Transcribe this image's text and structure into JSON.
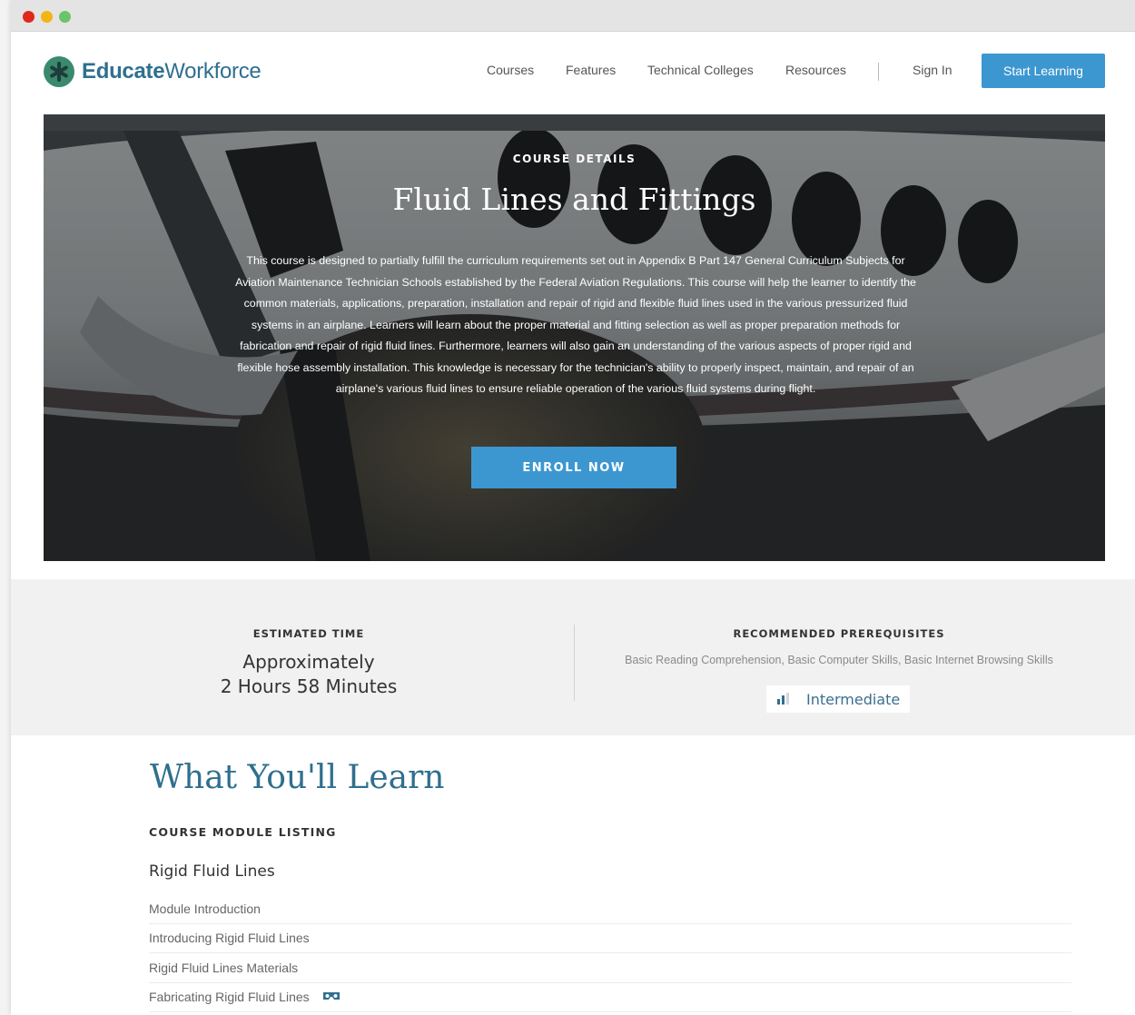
{
  "brand": {
    "name_part1": "Educate",
    "name_part2": "Workforce",
    "accent_color": "#3c97d1",
    "logo_color": "#2f6f8f"
  },
  "nav": {
    "items": [
      "Courses",
      "Features",
      "Technical Colleges",
      "Resources"
    ],
    "sign_in": "Sign In",
    "cta": "Start Learning"
  },
  "hero": {
    "eyebrow": "COURSE DETAILS",
    "title": "Fluid Lines and Fittings",
    "description": "This course is designed to partially fulfill the curriculum requirements set out in Appendix B Part 147 General Curriculum Subjects for Aviation Maintenance Technician Schools established by the Federal Aviation Regulations. This course will help the learner to identify the common materials, applications, preparation, installation and repair of rigid and flexible fluid lines used in the various pressurized fluid systems in an airplane. Learners will learn about the proper material and fitting selection as well as proper preparation methods for fabrication and repair of rigid fluid lines. Furthermore, learners will also gain an understanding of the various aspects of proper rigid and flexible hose assembly installation. This knowledge is necessary for the technician's ability to properly inspect, maintain, and repair of an airplane's various fluid lines to ensure reliable operation of the various fluid systems during flight.",
    "enroll_label": "ENROLL NOW"
  },
  "info": {
    "time_label": "ESTIMATED TIME",
    "time_line1": "Approximately",
    "time_line2": "2 Hours 58 Minutes",
    "prereq_label": "RECOMMENDED PREREQUISITES",
    "prereq_value": "Basic Reading Comprehension, Basic Computer Skills, Basic Internet Browsing Skills",
    "level": "Intermediate",
    "level_icon": "bar-chart-icon"
  },
  "learn": {
    "title": "What You'll Learn",
    "listing_label": "COURSE MODULE LISTING",
    "section_title": "Rigid Fluid Lines",
    "modules": [
      "Module Introduction",
      "Introducing Rigid Fluid Lines",
      "Rigid Fluid Lines Materials",
      "Fabricating Rigid Fluid Lines"
    ],
    "vr_icon": "vr-headset-icon"
  }
}
